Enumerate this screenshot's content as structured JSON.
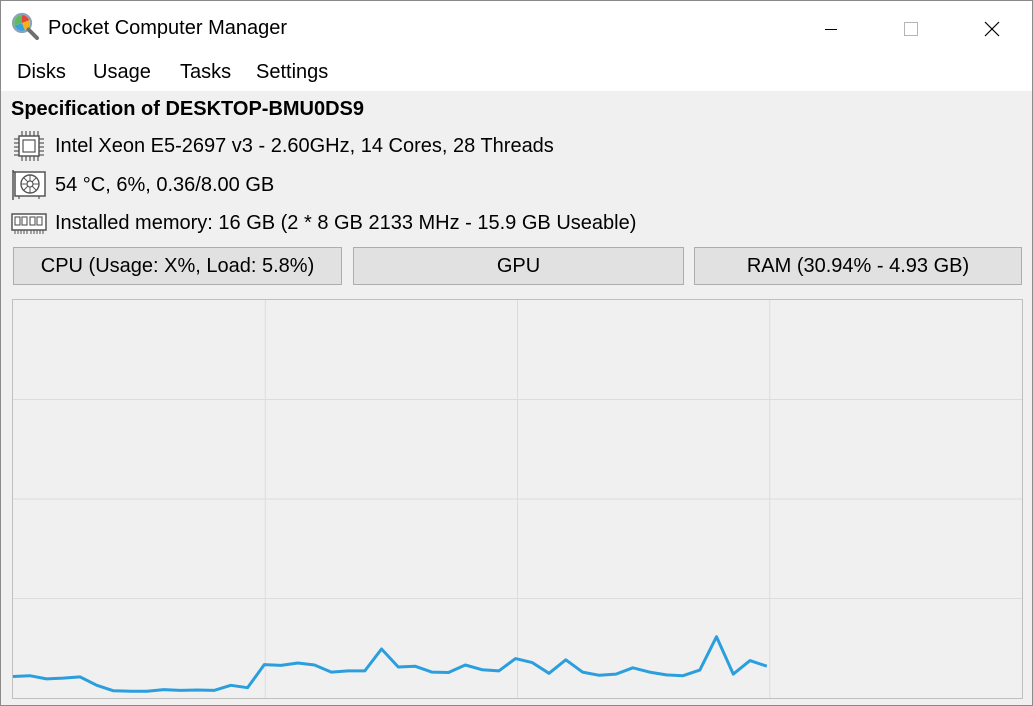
{
  "window": {
    "title": "Pocket Computer Manager",
    "icon": "magnifier-chart-icon"
  },
  "menu": [
    "Disks",
    "Usage",
    "Tasks",
    "Settings"
  ],
  "spec": {
    "title": "Specification of DESKTOP-BMU0DS9",
    "cpu": "Intel Xeon E5-2697 v3 - 2.60GHz, 14 Cores, 28 Threads",
    "gpu": "54 °C,  6%, 0.36/8.00 GB",
    "memory": "Installed memory: 16 GB (2 * 8 GB 2133 MHz - 15.9 GB Useable)"
  },
  "tabs": {
    "cpu": "CPU (Usage: X%, Load: 5.8%)",
    "gpu": "GPU",
    "ram": "RAM (30.94% - 4.93 GB)"
  },
  "colors": {
    "line": "#2b9ede",
    "grid": "#dcdcdc"
  },
  "chart_data": {
    "type": "line",
    "ylim": [
      0,
      100
    ],
    "grid": true,
    "series": [
      {
        "values": [
          5.4,
          5.6,
          4.8,
          5.0,
          5.3,
          3.2,
          1.8,
          1.7,
          1.7,
          2.1,
          1.9,
          2.0,
          1.9,
          3.2,
          2.6,
          8.4,
          8.2,
          8.8,
          8.3,
          6.5,
          6.8,
          6.8,
          12.3,
          7.8,
          8.0,
          6.5,
          6.4,
          8.3,
          7.1,
          6.8,
          9.9,
          8.9,
          6.2,
          9.6,
          6.5,
          5.7,
          6.0,
          7.6,
          6.5,
          5.8,
          5.6,
          7.0,
          15.4,
          6.0,
          9.4,
          8.0
        ]
      }
    ]
  }
}
